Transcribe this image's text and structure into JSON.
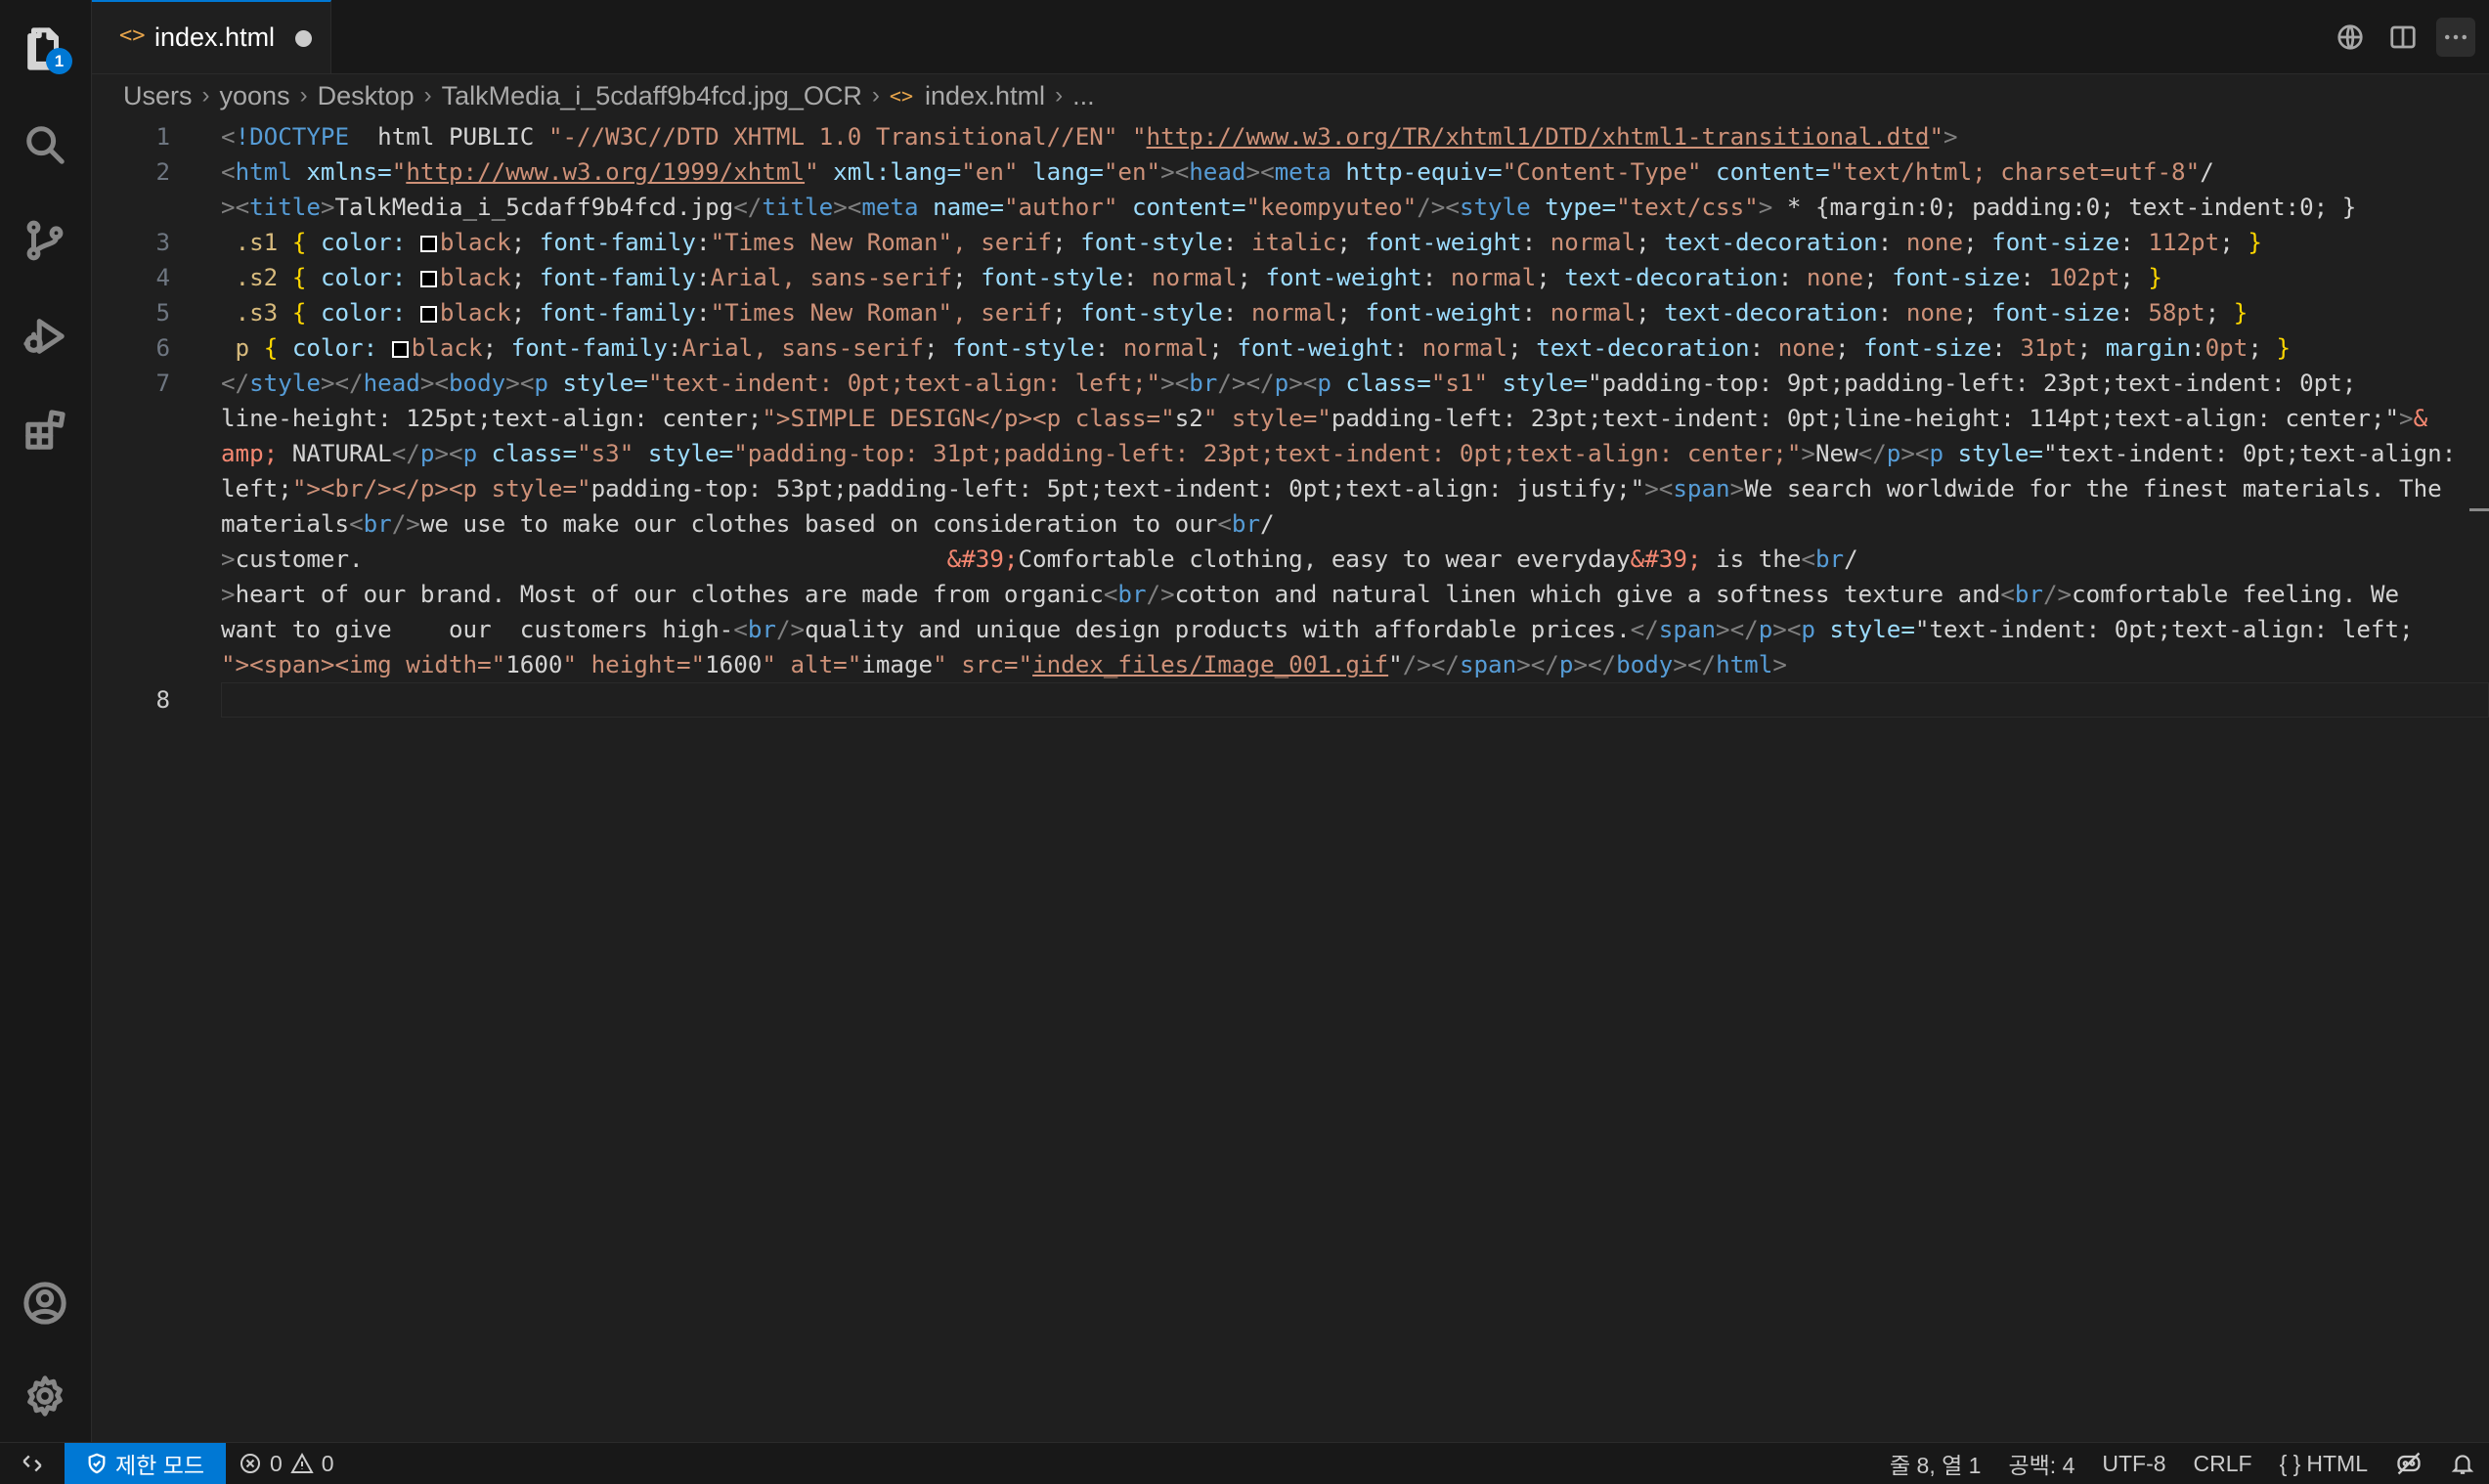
{
  "tab": {
    "label": "index.html",
    "icon": "html-file-icon",
    "modified": true
  },
  "breadcrumb": {
    "items": [
      "Users",
      "yoons",
      "Desktop",
      "TalkMedia_i_5cdaff9b4fcd.jpg_OCR",
      "index.html",
      "..."
    ]
  },
  "activity_bar": {
    "explorer_badge": "1",
    "icons": [
      "explorer-icon",
      "search-icon",
      "source-control-icon",
      "run-debug-icon",
      "extensions-icon",
      "account-icon",
      "settings-gear-icon"
    ]
  },
  "editor": {
    "line_numbers": [
      "1",
      "2",
      "3",
      "4",
      "5",
      "6",
      "7",
      "8"
    ],
    "current_line": "8",
    "visual_lines": [
      "<!DOCTYPE  html PUBLIC \"-//W3C//DTD XHTML 1.0 Transitional//EN\" \"http://www.w3.org/TR/xhtml1/DTD/xhtml1-transitional.dtd\">",
      "<html xmlns=\"http://www.w3.org/1999/xhtml\" xml:lang=\"en\" lang=\"en\"><head><meta http-equiv=\"Content-Type\" content=\"text/html; charset=utf-8\"/",
      "><title>TalkMedia_i_5cdaff9b4fcd.jpg</title><meta name=\"author\" content=\"keompyuteo\"/><style type=\"text/css\"> * {margin:0; padding:0; text-indent:0; }",
      " .s1 { color: black; font-family:\"Times New Roman\", serif; font-style: italic; font-weight: normal; text-decoration: none; font-size: 112pt; }",
      " .s2 { color: black; font-family:Arial, sans-serif; font-style: normal; font-weight: normal; text-decoration: none; font-size: 102pt; }",
      " .s3 { color: black; font-family:\"Times New Roman\", serif; font-style: normal; font-weight: normal; text-decoration: none; font-size: 58pt; }",
      " p { color: black; font-family:Arial, sans-serif; font-style: normal; font-weight: normal; text-decoration: none; font-size: 31pt; margin:0pt; }",
      "</style></head><body><p style=\"text-indent: 0pt;text-align: left;\"><br/></p><p class=\"s1\" style=\"padding-top: 9pt;padding-left: 23pt;text-indent: 0pt;",
      "line-height: 125pt;text-align: center;\">SIMPLE DESIGN</p><p class=\"s2\" style=\"padding-left: 23pt;text-indent: 0pt;line-height: 114pt;text-align: center;\">&",
      "amp; NATURAL</p><p class=\"s3\" style=\"padding-top: 31pt;padding-left: 23pt;text-indent: 0pt;text-align: center;\">New</p><p style=\"text-indent: 0pt;text-align:",
      "left;\"><br/></p><p style=\"padding-top: 53pt;padding-left: 5pt;text-indent: 0pt;text-align: justify;\"><span>We search worldwide for the finest materials. The",
      "materials<br/>we use to make our clothes based on consideration to our<br/",
      ">customer.                                         &#39;Comfortable clothing, easy to wear everyday&#39; is the<br/",
      ">heart of our brand. Most of our clothes are made from organic<br/>cotton and natural linen which give a softness texture and<br/>comfortable feeling. We",
      "want to give    our  customers high-<br/>quality and unique design products with affordable prices.</span></p><p style=\"text-indent: 0pt;text-align: left;",
      "\"><span><img width=\"1600\" height=\"1600\" alt=\"image\" src=\"index_files/Image_001.gif\"/></span></p></body></html>",
      ""
    ]
  },
  "status_bar": {
    "restricted_mode": "제한 모드",
    "errors": "0",
    "warnings": "0",
    "cursor_position": "줄 8, 열 1",
    "indentation": "공백: 4",
    "encoding": "UTF-8",
    "line_ending": "CRLF",
    "language": "HTML",
    "language_icon": "{ }"
  },
  "colors": {
    "accent": "#0078d4",
    "editor_background": "#1f1f1f",
    "tag": "#569cd6",
    "attribute": "#9cdcfe",
    "string": "#ce9178"
  }
}
